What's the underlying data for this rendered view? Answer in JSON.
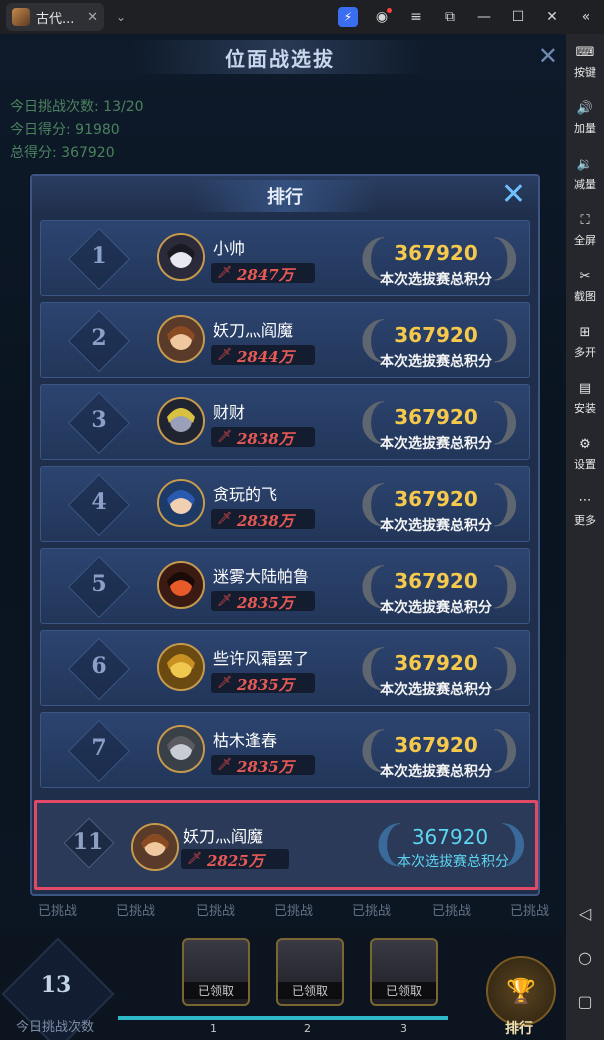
{
  "titlebar": {
    "tab_title": "古代...",
    "tab_close": "✕",
    "dropdown": "⌄"
  },
  "sidebar": {
    "items": [
      {
        "label": "按键",
        "icon": "keyboard-icon"
      },
      {
        "label": "加量",
        "icon": "volume-up-icon"
      },
      {
        "label": "减量",
        "icon": "volume-down-icon"
      },
      {
        "label": "全屏",
        "icon": "fullscreen-icon"
      },
      {
        "label": "截图",
        "icon": "scissors-icon"
      },
      {
        "label": "多开",
        "icon": "multi-instance-icon"
      },
      {
        "label": "安装",
        "icon": "apk-icon"
      },
      {
        "label": "设置",
        "icon": "gear-icon"
      },
      {
        "label": "更多",
        "icon": "more-icon"
      }
    ]
  },
  "game": {
    "title": "位面战选拔",
    "stats": {
      "challenges": "今日挑战次数: 13/20",
      "today_score": "今日得分: 91980",
      "total_score": "总得分: 367920"
    },
    "done_label": "已挑战",
    "bottom": {
      "count": "13",
      "count_label": "今日挑战次数",
      "chest_label": "已领取",
      "chest_nums": [
        "1",
        "2",
        "3"
      ],
      "rank_button": "排行",
      "progress": 1.0
    }
  },
  "modal": {
    "title": "排行",
    "close": "✕",
    "score_label": "本次选拔赛总积分",
    "rows": [
      {
        "rank": "1",
        "name": "小帅",
        "power": "2847万",
        "score": "367920"
      },
      {
        "rank": "2",
        "name": "妖刀灬阎魔",
        "power": "2844万",
        "score": "367920"
      },
      {
        "rank": "3",
        "name": "财财",
        "power": "2838万",
        "score": "367920"
      },
      {
        "rank": "4",
        "name": "贪玩的飞",
        "power": "2838万",
        "score": "367920"
      },
      {
        "rank": "5",
        "name": "迷雾大陆帕鲁",
        "power": "2835万",
        "score": "367920"
      },
      {
        "rank": "6",
        "name": "些许风霜罢了",
        "power": "2835万",
        "score": "367920"
      },
      {
        "rank": "7",
        "name": "枯木逢春",
        "power": "2835万",
        "score": "367920"
      }
    ],
    "self": {
      "rank": "11",
      "name": "妖刀灬阎魔",
      "power": "2825万",
      "score": "367920"
    }
  },
  "colors": {
    "accent_score": "#f6c94c",
    "self_score": "#5ed6f2",
    "highlight_border": "#e04a66",
    "power": "#e85a55"
  }
}
